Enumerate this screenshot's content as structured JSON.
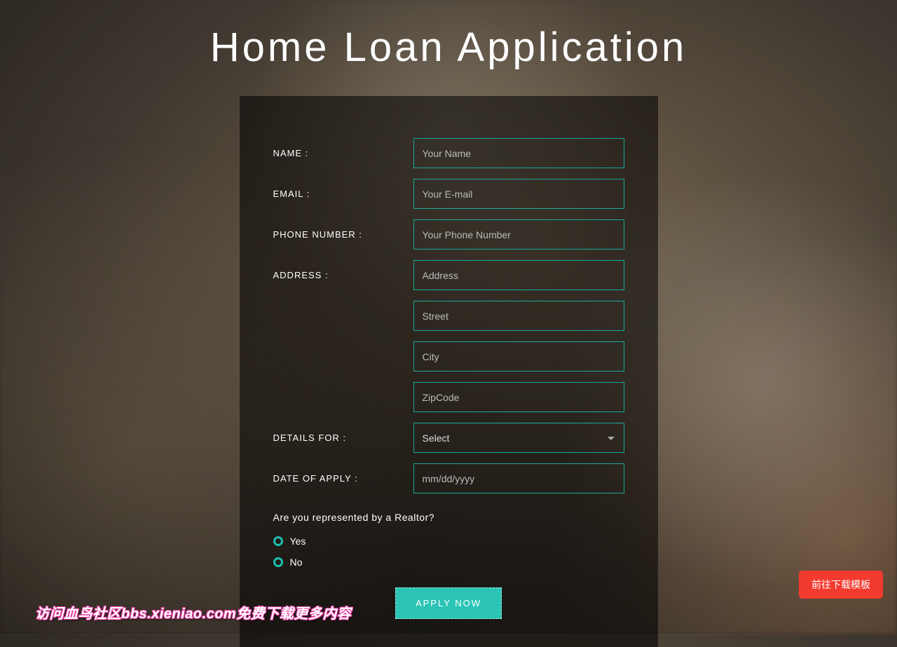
{
  "title": "Home Loan Application",
  "labels": {
    "name": "NAME :",
    "email": "EMAIL :",
    "phone": "PHONE NUMBER :",
    "address": "ADDRESS :",
    "details": "DETAILS FOR :",
    "date": "DATE OF APPLY :"
  },
  "placeholders": {
    "name": "Your Name",
    "email": "Your E-mail",
    "phone": "Your Phone Number",
    "address": "Address",
    "street": "Street",
    "city": "City",
    "zip": "ZipCode",
    "date": "mm/dd/yyyy"
  },
  "select": {
    "placeholder": "Select"
  },
  "question": "Are you represented by a Realtor?",
  "radios": {
    "yes": "Yes",
    "no": "No"
  },
  "submit": "APPLY NOW",
  "download_button": "前往下载模板",
  "watermark": "访问血鸟社区bbs.xieniao.com免费下载更多内容"
}
